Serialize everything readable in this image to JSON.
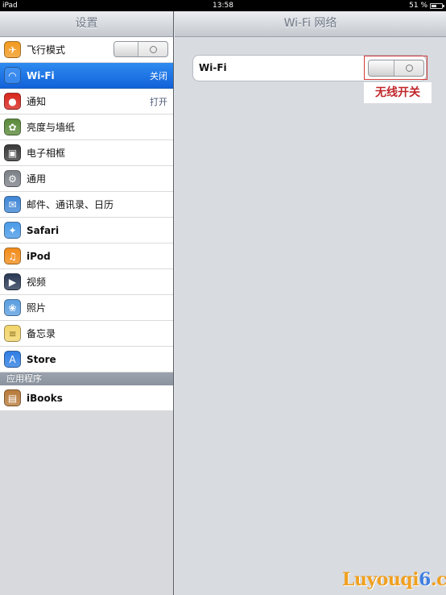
{
  "status_bar": {
    "device": "iPad",
    "time": "13:58",
    "battery": "51 %",
    "battery_level": 0.51
  },
  "sidebar": {
    "title": "设置",
    "items": [
      {
        "label": "飞行模式",
        "value": "",
        "icon": "airplane-icon",
        "toggle": "off",
        "color": "#f29a1f"
      },
      {
        "label": "Wi-Fi",
        "value": "关闭",
        "icon": "wifi-icon",
        "selected": true,
        "color": "#3f8ef0"
      },
      {
        "label": "通知",
        "value": "打开",
        "icon": "notifications-icon",
        "color": "#d8261d"
      },
      {
        "label": "亮度与墙纸",
        "value": "",
        "icon": "brightness-icon",
        "color": "#5b8a3b"
      },
      {
        "label": "电子相框",
        "value": "",
        "icon": "picture-frame-icon",
        "color": "#3a3a3a"
      },
      {
        "label": "通用",
        "value": "",
        "icon": "gear-icon",
        "color": "#7d8289"
      },
      {
        "label": "邮件、通讯录、日历",
        "value": "",
        "icon": "mail-icon",
        "color": "#3f86d6"
      },
      {
        "label": "Safari",
        "value": "",
        "icon": "safari-compass-icon",
        "color": "#4a9be8"
      },
      {
        "label": "iPod",
        "value": "",
        "icon": "ipod-icon",
        "color": "#f28c19"
      },
      {
        "label": "视频",
        "value": "",
        "icon": "video-clapper-icon",
        "color": "#2b3a55"
      },
      {
        "label": "照片",
        "value": "",
        "icon": "sunflower-icon",
        "color": "#5b9ee0"
      },
      {
        "label": "备忘录",
        "value": "",
        "icon": "notes-icon",
        "color": "#f2d56b"
      },
      {
        "label": "Store",
        "value": "",
        "icon": "app-store-icon",
        "color": "#2f7ee3"
      }
    ],
    "section_header": "应用程序",
    "app_items": [
      {
        "label": "iBooks",
        "value": "",
        "icon": "ibooks-icon",
        "color": "#b87a3a"
      }
    ]
  },
  "detail": {
    "title": "Wi-Fi 网络",
    "wifi_label": "Wi-Fi",
    "wifi_state": "off"
  },
  "annotation": {
    "text": "无线开关"
  },
  "watermark": {
    "main": "Luyouqi",
    "accent": "6",
    "suffix": ".cn"
  },
  "colors": {
    "selection": "#1a6fe3",
    "annotation_red": "#c0262b"
  }
}
